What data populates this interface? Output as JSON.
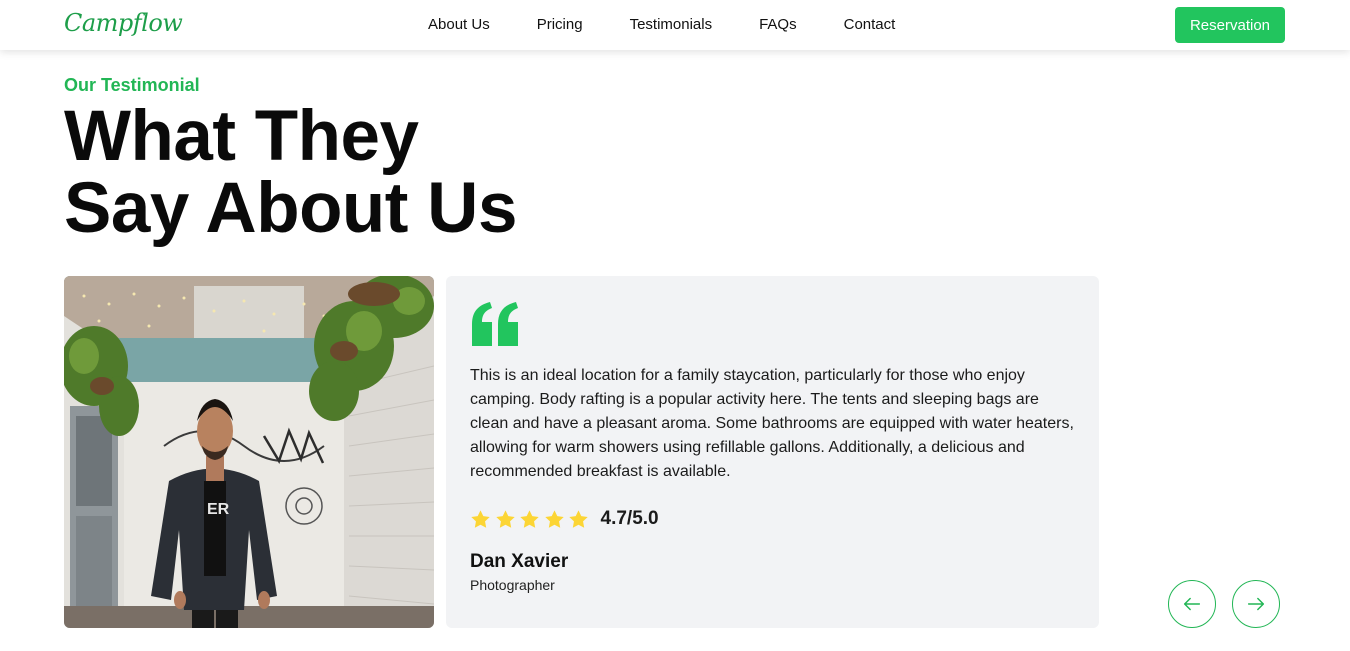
{
  "brand": {
    "name": "Campflow",
    "accent": "#22c55e"
  },
  "nav": {
    "items": [
      {
        "label": "About Us"
      },
      {
        "label": "Pricing"
      },
      {
        "label": "Testimonials"
      },
      {
        "label": "FAQs"
      },
      {
        "label": "Contact"
      }
    ],
    "cta_label": "Reservation"
  },
  "section": {
    "eyebrow": "Our Testimonial",
    "title_line1": "What They",
    "title_line2": "Say About Us"
  },
  "testimonial": {
    "photo_alt": "Portrait of Dan Xavier",
    "quote_icon": "quote-icon",
    "text": "This is an ideal location for a family staycation, particularly for those who enjoy camping. Body rafting is a popular activity here. The tents and sleeping bags are clean and have a pleasant aroma. Some bathrooms are equipped with water heaters, allowing for warm showers using refillable gallons. Additionally, a delicious and recommended breakfast is available.",
    "rating_stars": 5,
    "rating_label": "4.7/5.0",
    "author_name": "Dan Xavier",
    "author_role": "Photographer"
  },
  "controls": {
    "prev_icon": "arrow-left-icon",
    "next_icon": "arrow-right-icon"
  }
}
